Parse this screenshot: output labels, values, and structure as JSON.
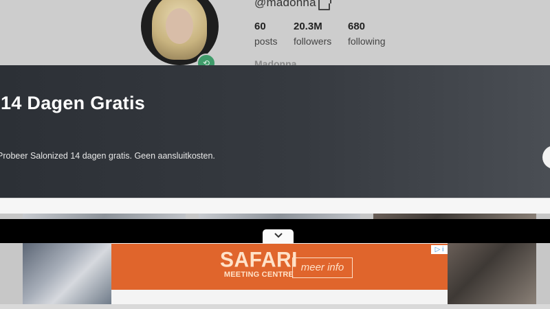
{
  "profile": {
    "handle": "@madonna",
    "posts_count": "60",
    "posts_label": "posts",
    "followers_count": "20.3M",
    "followers_label": "followers",
    "following_count": "680",
    "following_label": "following",
    "display_name": "Madonna"
  },
  "banner": {
    "title": "14 Dagen Gratis",
    "text": "Probeer Salonized 14 dagen gratis. Geen aansluitkosten."
  },
  "ad": {
    "brand": "SAFARI",
    "subbrand": "MEETING CENTRE",
    "cta": "meer info",
    "choices_label": "▷ i"
  },
  "colors": {
    "banner_bg": "#34383e",
    "ad_orange": "#e0652c",
    "verify_green": "#3f9b6a"
  }
}
